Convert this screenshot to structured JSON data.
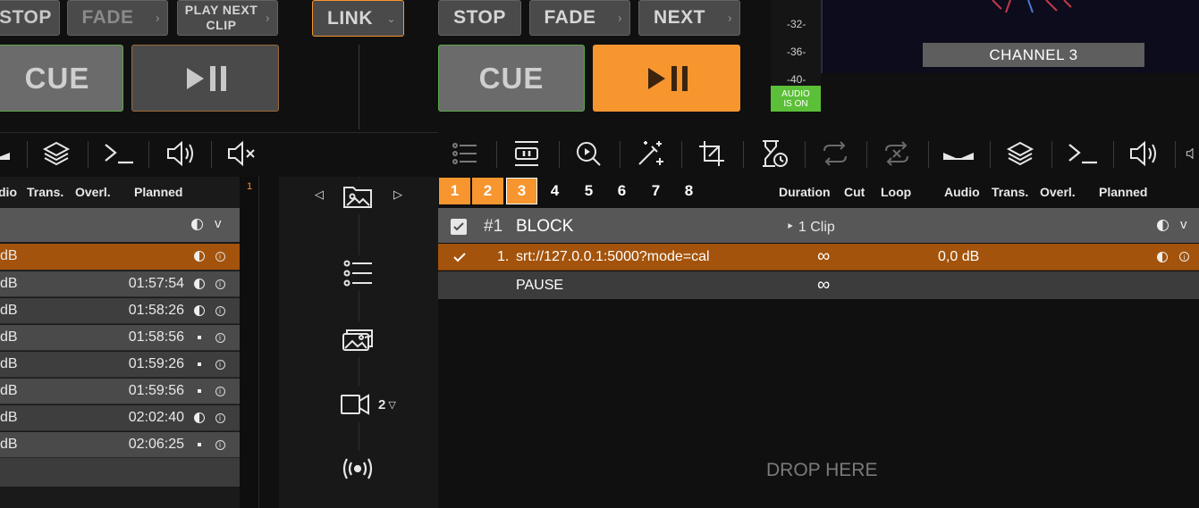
{
  "left_deck": {
    "stop_label": "STOP",
    "fade_label": "FADE",
    "play_next_label": "PLAY NEXT CLIP",
    "cue_label": "CUE",
    "link_label": "LINK"
  },
  "right_deck": {
    "stop_label": "STOP",
    "fade_label": "FADE",
    "next_label": "NEXT",
    "cue_label": "CUE"
  },
  "meter": {
    "ticks": [
      "-32-",
      "-36-",
      "-40-"
    ],
    "audio_status": "AUDIO IS ON"
  },
  "preview": {
    "channel_label": "CHANNEL 3"
  },
  "left_table": {
    "headers": [
      "dio",
      "Trans.",
      "Overl.",
      "Planned"
    ],
    "line_number": "1",
    "rows": [
      {
        "db": "dB",
        "time": "",
        "status": "half"
      },
      {
        "db": "dB",
        "time": "01:57:54",
        "status": "half"
      },
      {
        "db": "dB",
        "time": "01:58:26",
        "status": "half"
      },
      {
        "db": "dB",
        "time": "01:58:56",
        "status": "dot"
      },
      {
        "db": "dB",
        "time": "01:59:26",
        "status": "dot"
      },
      {
        "db": "dB",
        "time": "01:59:56",
        "status": "dot"
      },
      {
        "db": "dB",
        "time": "02:02:40",
        "status": "half"
      },
      {
        "db": "dB",
        "time": "02:06:25",
        "status": "dot"
      }
    ]
  },
  "side_panel": {
    "camera_count": "2"
  },
  "right_table": {
    "tabs": [
      "1",
      "2",
      "3",
      "4",
      "5",
      "6",
      "7",
      "8"
    ],
    "headers": [
      "Duration",
      "Cut",
      "Loop",
      "Audio",
      "Trans.",
      "Overl.",
      "Planned"
    ],
    "block": {
      "number": "#1",
      "name": "BLOCK",
      "clip_count": "‣ 1 Clip"
    },
    "clip_row": {
      "index": "1.",
      "source": "srt://127.0.0.1:5000?mode=cal",
      "duration": "∞",
      "audio": "0,0 dB"
    },
    "pause_row": {
      "label": "PAUSE",
      "duration": "∞"
    },
    "drop_label": "DROP HERE"
  },
  "colors": {
    "accent_orange": "#f7952f",
    "row_highlight": "#a3530b",
    "cue_border": "#5aa64a",
    "audio_on": "#5bbf38"
  }
}
